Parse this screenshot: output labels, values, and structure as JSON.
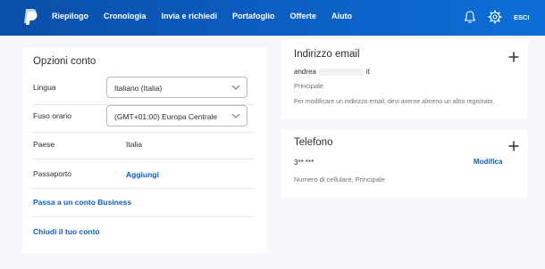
{
  "header": {
    "nav": [
      "Riepilogo",
      "Cronologia",
      "Invia e richiedi",
      "Portafoglio",
      "Offerte",
      "Aiuto"
    ],
    "logout_label": "ESCI"
  },
  "options": {
    "title": "Opzioni conto",
    "language_label": "Lingua",
    "language_value": "Italiano (Italia)",
    "timezone_label": "Fuso orario",
    "timezone_value": "(GMT+01:00) Europa Centrale",
    "country_label": "Paese",
    "country_value": "Italia",
    "passport_label": "Passaporto",
    "passport_action": "Aggiungi",
    "upgrade_link": "Passa a un conto Business",
    "close_link": "Chiudi il tuo conto"
  },
  "email": {
    "title": "Indirizzo email",
    "address_start": "andrea",
    "address_end": "it",
    "type": "Principale",
    "note": "Per modificare un indirizzo email, devi averne almeno un altro registrato."
  },
  "phone": {
    "title": "Telefono",
    "number": "3** ***",
    "edit_label": "Modifica",
    "description": "Numero di cellulare, Principale"
  }
}
